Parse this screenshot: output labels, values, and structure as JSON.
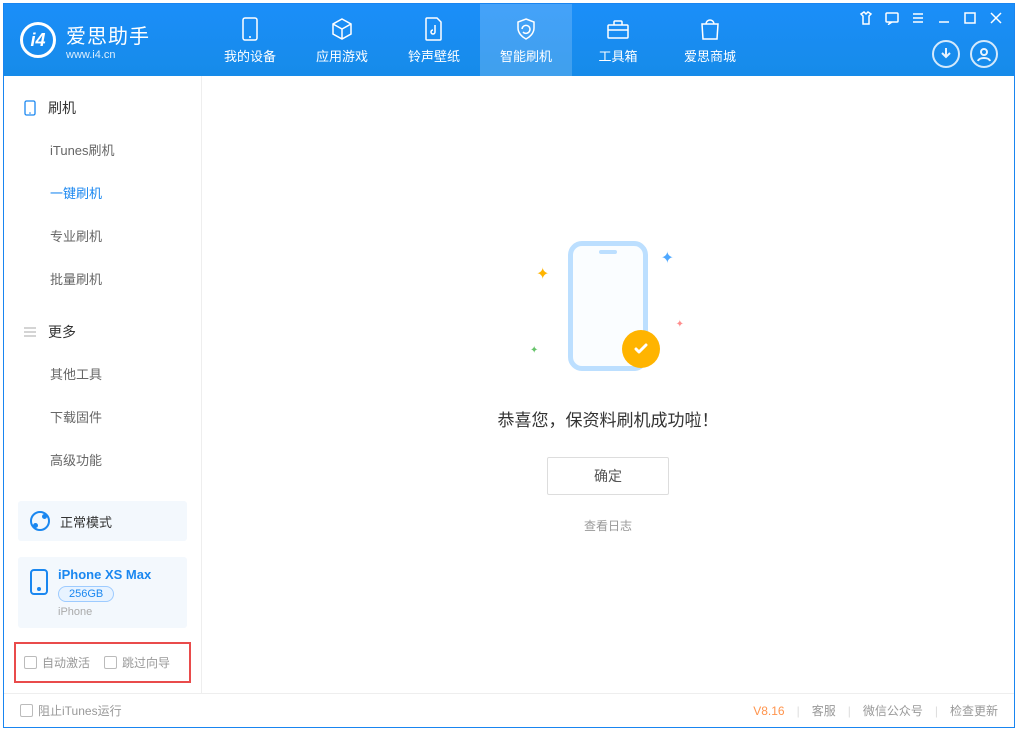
{
  "app": {
    "name": "爱思助手",
    "url": "www.i4.cn"
  },
  "tabs": {
    "device": "我的设备",
    "apps": "应用游戏",
    "ring": "铃声壁纸",
    "flash": "智能刷机",
    "tools": "工具箱",
    "store": "爱思商城"
  },
  "sidebar": {
    "section1": "刷机",
    "items1": {
      "itunes": "iTunes刷机",
      "oneclick": "一键刷机",
      "pro": "专业刷机",
      "batch": "批量刷机"
    },
    "section2": "更多",
    "items2": {
      "other": "其他工具",
      "firmware": "下载固件",
      "advanced": "高级功能"
    },
    "mode": "正常模式",
    "device": {
      "name": "iPhone XS Max",
      "storage": "256GB",
      "type": "iPhone"
    },
    "checks": {
      "auto": "自动激活",
      "skip": "跳过向导"
    }
  },
  "main": {
    "success": "恭喜您，保资料刷机成功啦！",
    "ok": "确定",
    "log": "查看日志"
  },
  "footer": {
    "blockItunes": "阻止iTunes运行",
    "version": "V8.16",
    "support": "客服",
    "wechat": "微信公众号",
    "update": "检查更新"
  }
}
